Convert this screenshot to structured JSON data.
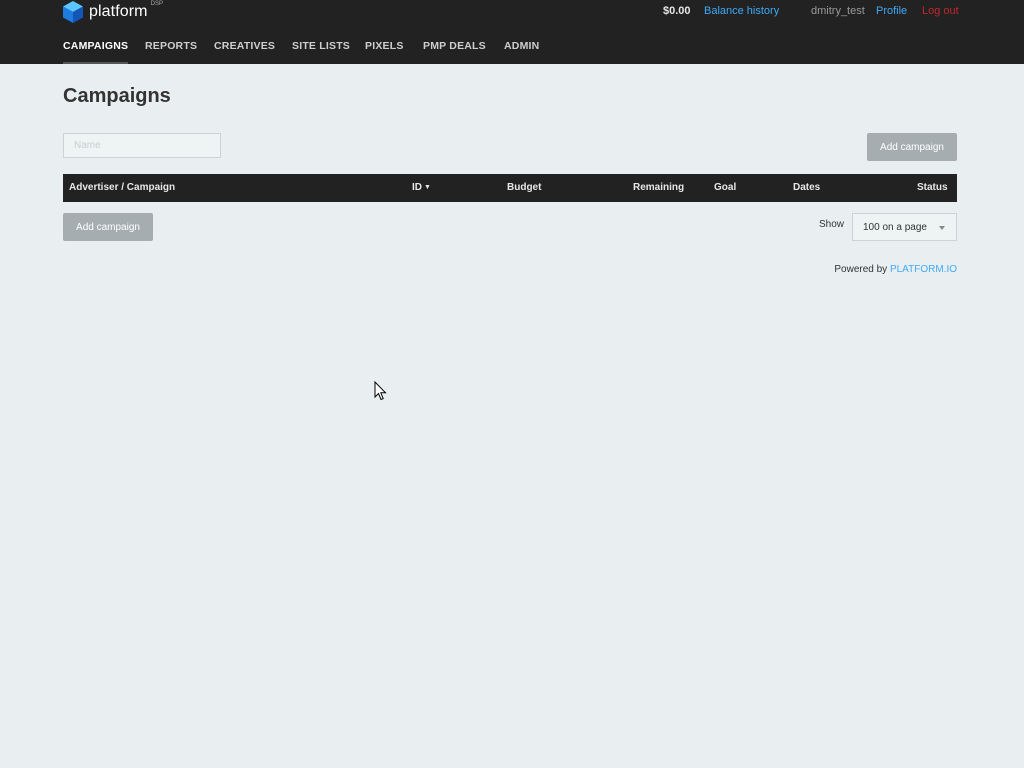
{
  "header": {
    "logo_text": "platform",
    "logo_sup": "DSP",
    "balance": "$0.00",
    "balance_history": "Balance history",
    "username": "dmitry_test",
    "profile": "Profile",
    "logout": "Log out"
  },
  "nav": {
    "items": [
      {
        "label": "CAMPAIGNS",
        "active": true
      },
      {
        "label": "REPORTS"
      },
      {
        "label": "CREATIVES"
      },
      {
        "label": "SITE LISTS"
      },
      {
        "label": "PIXELS"
      },
      {
        "label": "PMP DEALS"
      },
      {
        "label": "ADMIN"
      }
    ]
  },
  "main": {
    "title": "Campaigns",
    "search_placeholder": "Name",
    "add_campaign": "Add campaign",
    "table": {
      "columns": [
        "Advertiser / Campaign",
        "ID",
        "Budget",
        "Remaining",
        "Goal",
        "Dates",
        "Status"
      ],
      "sort_indicator": "▼",
      "rows": []
    },
    "show_label": "Show",
    "page_size": "100 on a page"
  },
  "footer": {
    "powered_by": "Powered by",
    "link": "PLATFORM.IO"
  },
  "icons": {
    "logo": "cube-logo-icon",
    "sort": "sort-down-icon",
    "dropdown": "chevron-down-icon",
    "cursor": "mouse-pointer-icon"
  },
  "colors": {
    "topbar": "#222222",
    "background": "#e9eff0",
    "link": "#3fa9f5",
    "logout": "#c0282d",
    "button": "#a6adb0"
  }
}
